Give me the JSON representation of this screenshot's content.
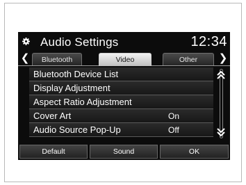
{
  "header": {
    "title": "Audio Settings",
    "clock": "12:34"
  },
  "tabs": [
    {
      "label": "Bluetooth",
      "active": false
    },
    {
      "label": "Video",
      "active": true
    },
    {
      "label": "Other",
      "active": false
    }
  ],
  "menu": [
    {
      "label": "Bluetooth Device List",
      "value": ""
    },
    {
      "label": "Display Adjustment",
      "value": ""
    },
    {
      "label": "Aspect Ratio Adjustment",
      "value": ""
    },
    {
      "label": "Cover Art",
      "value": "On"
    },
    {
      "label": "Audio Source Pop-Up",
      "value": "Off"
    }
  ],
  "buttons": {
    "default_label": "Default",
    "sound_label": "Sound",
    "ok_label": "OK"
  },
  "icons": {
    "settings": "gear-icon",
    "prev_tab": "chevron-left-icon",
    "next_tab": "chevron-right-icon",
    "scroll_up": "double-chevron-up-icon",
    "scroll_down": "double-chevron-down-icon"
  }
}
